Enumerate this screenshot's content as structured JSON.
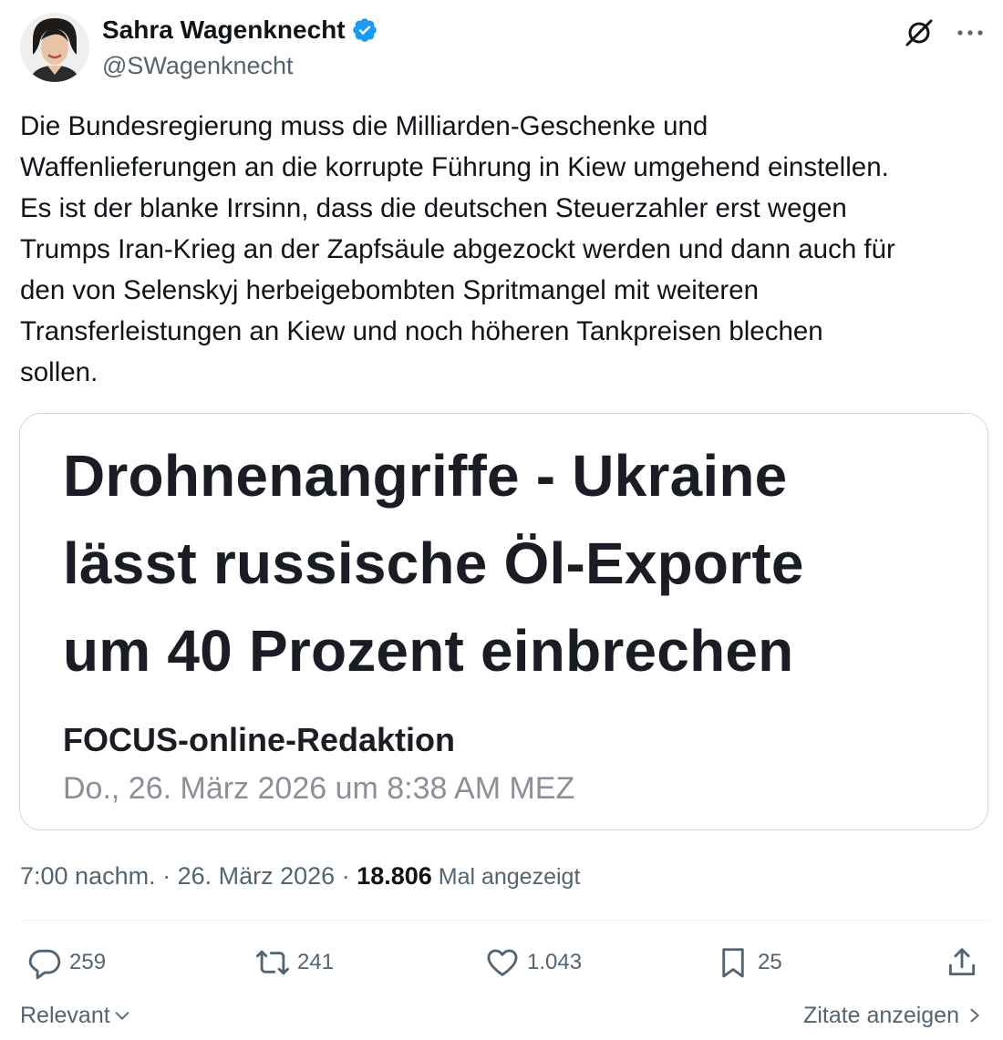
{
  "author": {
    "name": "Sahra Wagenknecht",
    "handle": "@SWagenknecht",
    "verified_icon": "verified-badge-icon",
    "verified_color": "#1d9bf0"
  },
  "tweet": {
    "lines": [
      "Die Bundesregierung muss die Milliarden-Geschenke und",
      "Waffenlieferungen an die korrupte Führung in Kiew umgehend einstellen.",
      "Es ist der blanke Irrsinn, dass die deutschen Steuerzahler erst wegen",
      "Trumps Iran-Krieg an der Zapfsäule abgezockt werden und dann auch für",
      "den von Selenskyj herbeigebombten Spritmangel mit weiteren",
      "Transferleistungen an Kiew und noch höheren Tankpreisen blechen",
      "sollen."
    ]
  },
  "card": {
    "headline_lines": [
      "Drohnenangriffe - Ukraine",
      "lässt russische Öl-Exporte",
      "um 40 Prozent einbrechen"
    ],
    "author": "FOCUS-online-Redaktion",
    "date": "Do., 26. März 2026 um 8:38 AM MEZ"
  },
  "meta": {
    "time": "7:00 nachm.",
    "sep1": " · ",
    "date": "26. März 2026",
    "sep2": " · ",
    "views_count": "18.806",
    "views_label": " Mal angezeigt"
  },
  "actions": {
    "replies": "259",
    "reposts": "241",
    "likes": "1.043",
    "bookmarks": "25"
  },
  "footer": {
    "sort_label": "Relevant",
    "quotes_label": "Zitate anzeigen"
  },
  "colors": {
    "text": "#0f1419",
    "secondary": "#536471",
    "border": "#cfd9de"
  }
}
